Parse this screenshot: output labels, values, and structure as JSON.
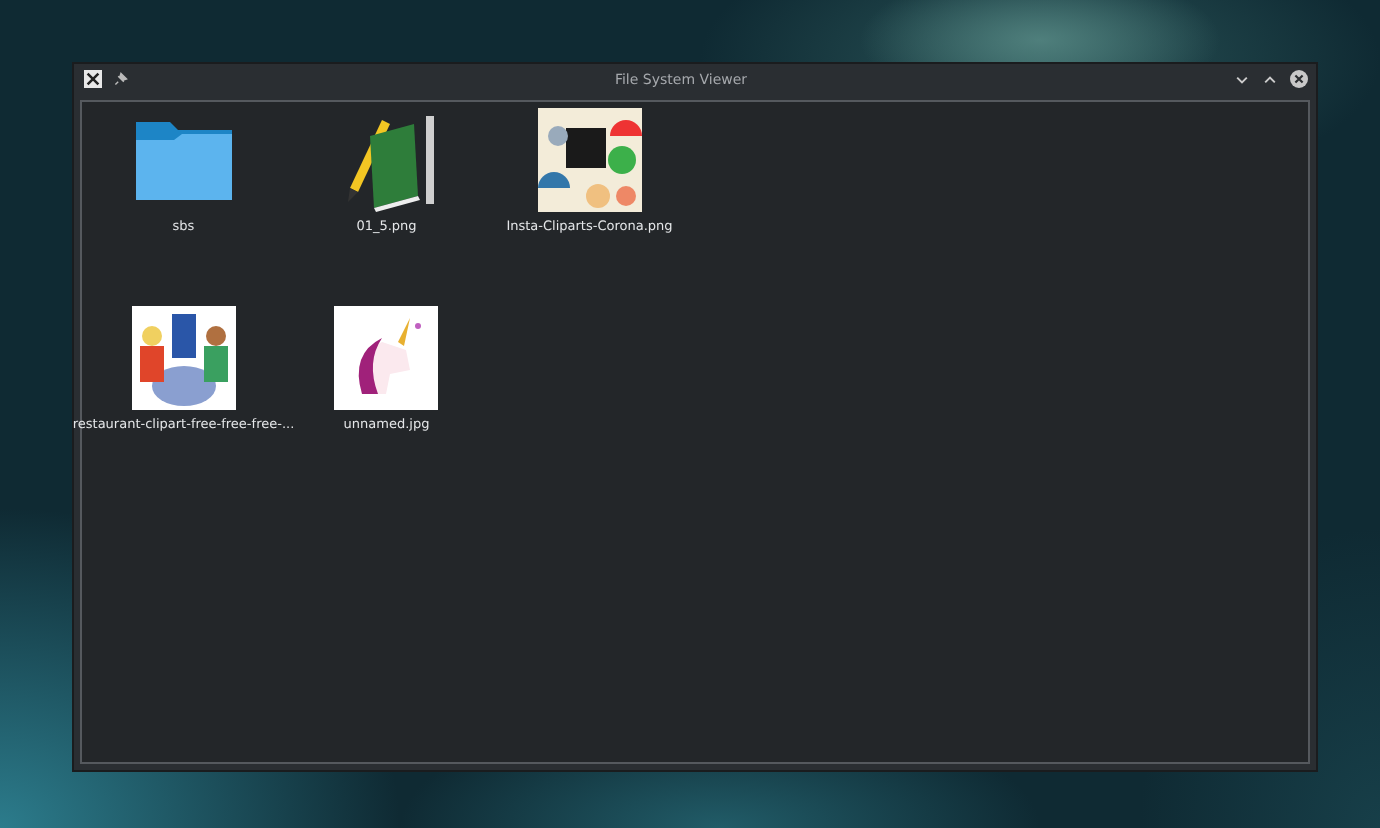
{
  "window": {
    "title": "File System Viewer"
  },
  "files": [
    {
      "name": "sbs",
      "kind": "folder"
    },
    {
      "name": "01_5.png"
    },
    {
      "name": "Insta-Cliparts-Corona.png"
    },
    {
      "name": "restaurant-clipart-free-free-free-..."
    },
    {
      "name": "unnamed.jpg"
    }
  ]
}
